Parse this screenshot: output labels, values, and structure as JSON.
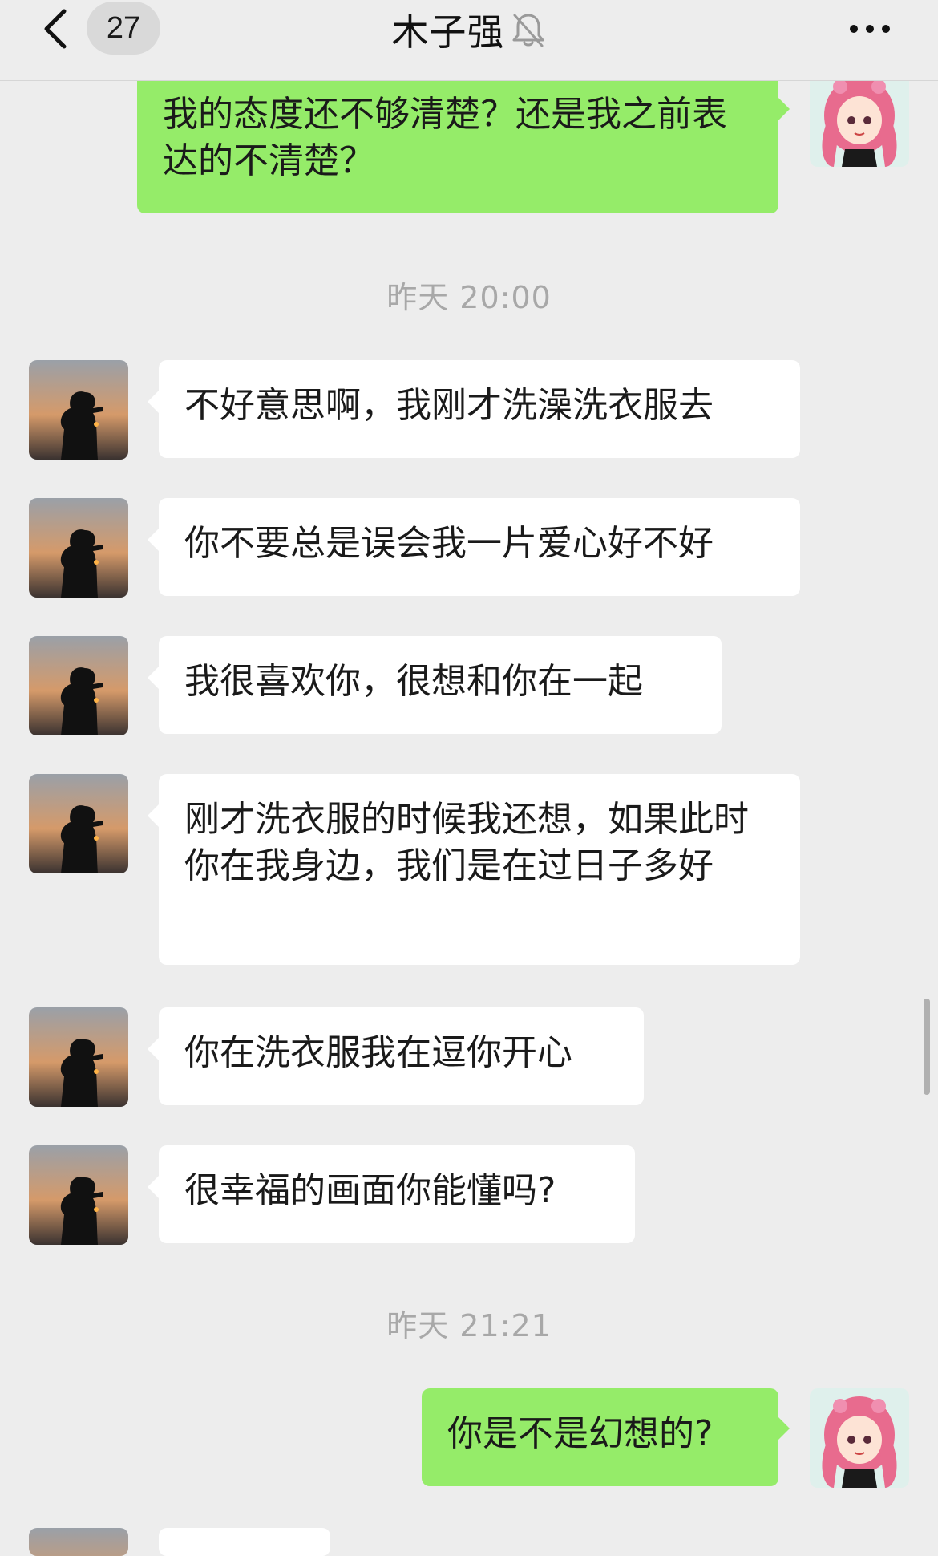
{
  "header": {
    "back_icon": "chevron-left-icon",
    "unread_count": "27",
    "title": "木子强",
    "mute_icon": "bell-off-icon",
    "more_icon": "more-icon"
  },
  "messages": [
    {
      "id": "m0",
      "side": "right",
      "text": "我的态度还不够清楚？还是我之前表达的不清楚？"
    },
    {
      "id": "ts1",
      "type": "timestamp",
      "text": "昨天 20:00"
    },
    {
      "id": "m1",
      "side": "left",
      "text": "不好意思啊，我刚才洗澡洗衣服去"
    },
    {
      "id": "m2",
      "side": "left",
      "text": "你不要总是误会我一片爱心好不好"
    },
    {
      "id": "m3",
      "side": "left",
      "text": "我很喜欢你，很想和你在一起"
    },
    {
      "id": "m4",
      "side": "left",
      "text": "刚才洗衣服的时候我还想，如果此时你在我身边，我们是在过日子多好"
    },
    {
      "id": "m5",
      "side": "left",
      "text": "你在洗衣服我在逗你开心"
    },
    {
      "id": "m6",
      "side": "left",
      "text": "很幸福的画面你能懂吗?"
    },
    {
      "id": "ts2",
      "type": "timestamp",
      "text": "昨天 21:21"
    },
    {
      "id": "m7",
      "side": "right",
      "text": "你是不是幻想的?"
    },
    {
      "id": "m8",
      "side": "left",
      "text": ""
    }
  ],
  "colors": {
    "background": "#ededed",
    "outgoing_bubble": "#95ec69",
    "incoming_bubble": "#ffffff",
    "timestamp_text": "#a8a8a8"
  }
}
